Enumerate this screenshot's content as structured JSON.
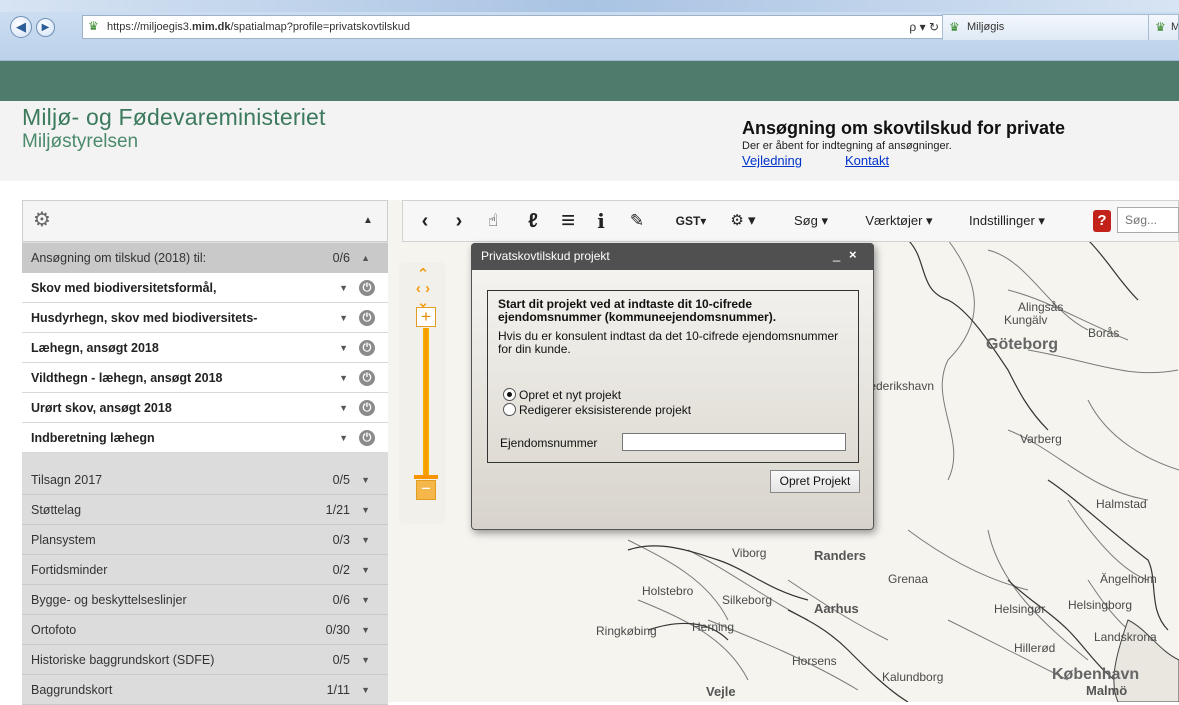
{
  "browser": {
    "url_prefix": "https://miljoegis3.",
    "url_domain": "mim.dk",
    "url_suffix": "/spatialmap?profile=privatskovtilskud",
    "search_tools": "ρ ▾ ↻",
    "tabs": [
      {
        "label": "Miljøgis"
      },
      {
        "label": "Milj"
      }
    ],
    "back_icon": "back-arrow-icon",
    "forward_icon": "forward-arrow-icon"
  },
  "header": {
    "ministry": "Miljø- og Fødevareministeriet",
    "agency": "Miljøstyrelsen",
    "title": "Ansøgning om skovtilskud for private",
    "subtitle": "Der er åbent for indtegning af ansøgninger.",
    "link_guide": "Vejledning",
    "link_contact": "Kontakt"
  },
  "toolbar": {
    "prev": "‹",
    "next": "›",
    "pan": "☝",
    "info_user": "ℓ",
    "list": "≡",
    "info": "i",
    "measure": "✎",
    "gst": "GST▾",
    "tools_icon": "⚙ ▾",
    "search": "Søg ▾",
    "tools": "Værktøjer ▾",
    "settings": "Indstillinger ▾",
    "help": "?",
    "search_placeholder": "Søg..."
  },
  "panel": {
    "header_group": {
      "label": "Ansøgning om tilskud (2018) til:",
      "count": "0/6",
      "caret": "▲"
    },
    "active_layers": [
      {
        "label": "Skov med biodiversitetsformål,"
      },
      {
        "label": "Husdyrhegn, skov med biodiversitets-"
      },
      {
        "label": "Læhegn, ansøgt 2018"
      },
      {
        "label": "Vildthegn - læhegn, ansøgt 2018"
      },
      {
        "label": "Urørt skov, ansøgt 2018"
      },
      {
        "label": "Indberetning læhegn"
      }
    ],
    "groups": [
      {
        "label": "Tilsagn 2017",
        "count": "0/5"
      },
      {
        "label": "Støttelag",
        "count": "1/21"
      },
      {
        "label": "Plansystem",
        "count": "0/3"
      },
      {
        "label": "Fortidsminder",
        "count": "0/2"
      },
      {
        "label": "Bygge- og beskyttelseslinjer",
        "count": "0/6"
      },
      {
        "label": "Ortofoto",
        "count": "0/30"
      },
      {
        "label": "Historiske baggrundskort (SDFE)",
        "count": "0/5"
      },
      {
        "label": "Baggrundskort",
        "count": "1/11"
      }
    ]
  },
  "dialog": {
    "title": "Privatskovtilskud projekt",
    "minimize": "_",
    "close": "×",
    "intro_bold": "Start dit projekt ved at indtaste dit 10-cifrede ejendomsnummer (kommuneejendomsnummer).",
    "intro": "Hvis du er konsulent indtast da det 10-cifrede ejendomsnummer for din kunde.",
    "option_new": "Opret et nyt projekt",
    "option_edit": "Redigerer eksisisterende projekt",
    "selected_option": "new",
    "property_label": "Ejendomsnummer",
    "property_value": "",
    "create_button": "Opret Projekt"
  },
  "map": {
    "labels": [
      "Alingsås",
      "Kungälv",
      "Borås",
      "Göteborg",
      "Frederikshavn",
      "Varberg",
      "Halmstad",
      "Viborg",
      "Randers",
      "Grenaa",
      "Ängelholm",
      "Holstebro",
      "Silkeborg",
      "Aarhus",
      "Helsingør",
      "Helsingborg",
      "Ringkøbing",
      "Herning",
      "Landskrona",
      "Hillerød",
      "Horsens",
      "Kalundborg",
      "København",
      "Vejle",
      "Malmö"
    ]
  }
}
